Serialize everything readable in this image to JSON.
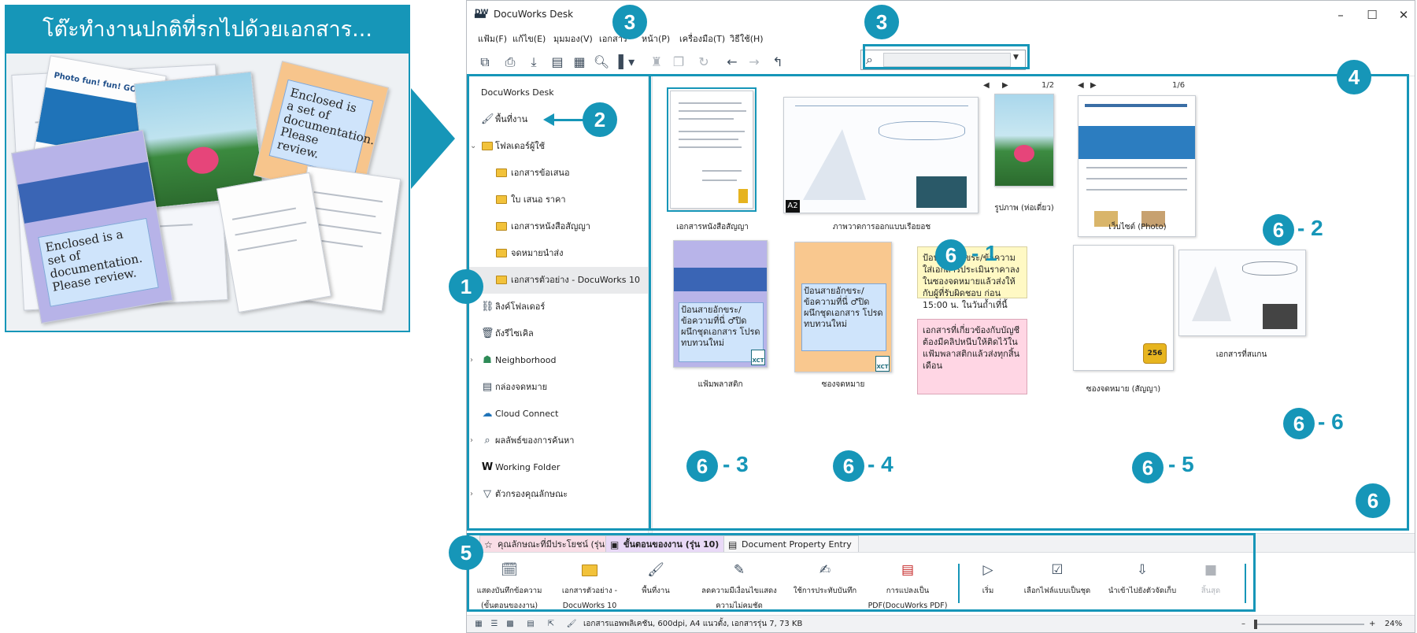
{
  "illustration": {
    "banner": "โต๊ะทำงานปกติที่รกไปด้วยเอกสาร...",
    "note_text": "Enclosed is a set of documentation. Please review.",
    "brochure_title": "Photo fun! fun! GO!"
  },
  "window": {
    "title": "DocuWorks Desk",
    "controls": {
      "minimize": "–",
      "maximize": "☐",
      "close": "✕"
    }
  },
  "menu": [
    "แฟ้ม(F)",
    "แก้ไข(E)",
    "มุมมอง(V)",
    "เอกสาร",
    "หน้า(P)",
    "เครื่องมือ(T)",
    "วิธีใช้(H)"
  ],
  "search": {
    "placeholder": ""
  },
  "sidebar": {
    "root": "DocuWorks Desk",
    "items": [
      {
        "label": "พื้นที่งาน",
        "icon": "broom-icon"
      },
      {
        "label": "โฟลเดอร์ผู้ใช้",
        "icon": "folder-icon"
      },
      {
        "label": "เอกสารข้อเสนอ",
        "icon": "folder-icon"
      },
      {
        "label": "ใบ เสนอ ราคา",
        "icon": "folder-icon"
      },
      {
        "label": "เอกสารหนังสือสัญญา",
        "icon": "folder-icon"
      },
      {
        "label": "จดหมายนำส่ง",
        "icon": "folder-icon"
      },
      {
        "label": "เอกสารตัวอย่าง - DocuWorks 10",
        "icon": "folder-icon"
      },
      {
        "label": "ลิงค์โฟลเดอร์",
        "icon": "link-folder-icon"
      },
      {
        "label": "ถังรีไซเคิล",
        "icon": "trash-icon"
      },
      {
        "label": "Neighborhood",
        "icon": "network-icon"
      },
      {
        "label": "กล่องจดหมาย",
        "icon": "mailbox-icon"
      },
      {
        "label": "Cloud Connect",
        "icon": "cloud-icon"
      },
      {
        "label": "ผลลัพธ์ของการค้นหา",
        "icon": "search-icon"
      },
      {
        "label": "Working Folder",
        "icon": "working-folder-icon"
      },
      {
        "label": "ตัวกรองคุณลักษณะ",
        "icon": "filter-icon"
      }
    ]
  },
  "documents": {
    "contract": "เอกสารหนังสือสัญญา",
    "drawing": "ภาพวาดการออกแบบเรือยอช",
    "photo": "รูปภาพ (ห่อเดี่ยว)",
    "website": "เว็บไซต์ (Photo)",
    "plastic_folder": "แฟ้มพลาสติก",
    "envelope": "ซองจดหมาย",
    "contract_envelope": "ซองจดหมาย (สัญญา)",
    "scanned": "เอกสารที่สแกน",
    "photo_pager": "1/2",
    "web_pager": "1/6",
    "a2_badge": "A2",
    "lock_label": "256",
    "xct": "XCT",
    "sticky_yellow": "ป้อนสายอักขระ/ข้อความใส่เอกสารประเมินราคาลงในซองจดหมายแล้วส่งให้กับผู้ที่รับผิดชอบ ก่อน 15:00 น. ในวันถ้ำเที่นี้",
    "sticky_pink": "เอกสารที่เกี่ยวข้องกับบัญชีต้องมีคลิปหนีบให้ติดไว้ในแฟ้มพลาสติกแล้วส่งทุกสิ้นเดือน",
    "folder_note": "ป้อนสายอักขระ/ข้อความที่นี่ ♂ปิดผนึกชุดเอกสาร โปรดทบทวนใหม่",
    "envelope_note": "ป้อนสายอักขระ/ข้อความที่นี่ ♂ปิดผนึกชุดเอกสาร โปรดทบทวนใหม่"
  },
  "ribbon": {
    "tabs": [
      "คุณลักษณะที่มีประโยชน์ (รุ่น 10)",
      "ขั้นตอนของงาน (รุ่น 10)",
      "Document Property Entry"
    ],
    "buttons": [
      "แสดงบันทึกข้อความ (ขั้นตอนของงาน)",
      "เอกสารตัวอย่าง - DocuWorks 10",
      "พื้นที่งาน",
      "ลดความมีเงื่อนไขแสดงความไม่คมชัด",
      "ใช้การประทับบันทึก",
      "การแปลงเป็น PDF(DocuWorks PDF)",
      "เริ่ม",
      "เลือกไฟล์แบบเป็นชุด",
      "นำเข้าไปยังตัวจัดเก็บ",
      "สิ้นสุด"
    ]
  },
  "status": {
    "text": "เอกสารแอพพลิเคชัน, 600dpi, A4 แนวตั้ง, เอกสารรุ่น 7, 73 KB",
    "zoom": "24%",
    "zoom_minus": "–",
    "zoom_plus": "+"
  },
  "callouts": {
    "c1": "1",
    "c2": "2",
    "c3": "3",
    "c4": "4",
    "c5": "5",
    "c6": "6",
    "s61": "- 1",
    "s62": "- 2",
    "s63": "- 3",
    "s64": "- 4",
    "s65": "- 5",
    "s66": "- 6"
  },
  "colors": {
    "accent": "#1696b8",
    "sticky_yellow": "#fff9c4",
    "sticky_pink": "#ffd6e4",
    "envelope": "#f9c88f"
  }
}
